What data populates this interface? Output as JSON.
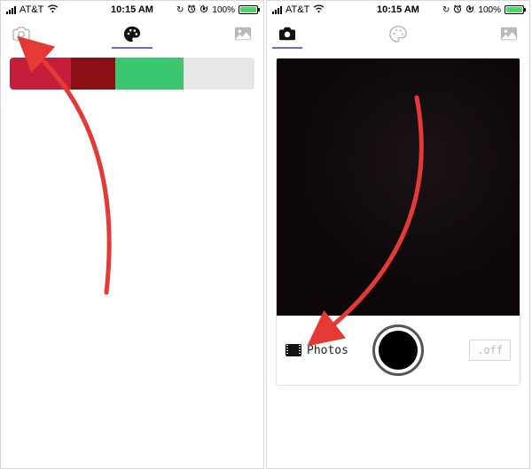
{
  "status": {
    "carrier": "AT&T",
    "time": "10:15 AM",
    "battery_percent": "100%",
    "alarm_glyph": "⏰",
    "dnd_glyph": "☾",
    "lock_glyph": "↻"
  },
  "colors": {
    "accent": "#7a5cff",
    "swatch1": "#c41e3a",
    "swatch2": "#8b0f17",
    "swatch3": "#3cc66e",
    "swatch4": "#e8e8e8",
    "arrow": "#e53935"
  },
  "left_screen": {
    "tabs": {
      "camera_icon": "camera-icon",
      "palette_icon": "palette-icon",
      "gallery_icon": "image-icon",
      "active": "palette"
    }
  },
  "right_screen": {
    "tabs": {
      "camera_icon": "camera-icon",
      "palette_icon": "palette-icon",
      "gallery_icon": "image-icon",
      "active": "camera"
    },
    "photos_label": "Photos",
    "flash_label": ".off"
  }
}
